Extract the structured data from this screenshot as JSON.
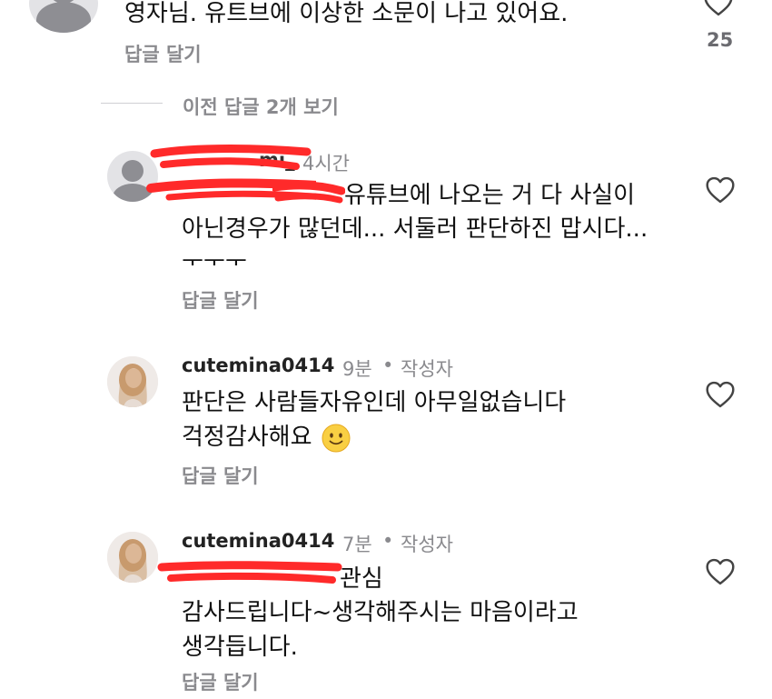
{
  "top_comment": {
    "text": "영자님.  유트브에 이상한 소문이 나고 있어요.",
    "reply_label": "답글 달기",
    "like_count": "25"
  },
  "view_previous": "이전 답글 2개 보기",
  "replies": [
    {
      "username_visible": "mi_",
      "time": "4시간",
      "line1_visible": "유튜브에 나오는 거 다 사실이",
      "line2": "아닌경우가 많던데... 서둘러 판단하진 맙시다...",
      "line3": "ㅜㅜㅜ",
      "reply_label": "답글 달기"
    },
    {
      "username": "cutemina0414",
      "time": "9분",
      "author_badge": "작성자",
      "line1": "판단은 사람들자유인데 아무일없습니다",
      "line2": "걱정감사해요",
      "reply_label": "답글 달기"
    },
    {
      "username": "cutemina0414",
      "time": "7분",
      "author_badge": "작성자",
      "line1_visible": "관심",
      "line2": "감사드립니다~생각해주시는 마음이라고",
      "line3": "생각듭니다.",
      "reply_label": "답글 달기"
    }
  ],
  "icons": {
    "heart": "heart-outline-icon",
    "default_avatar": "person-placeholder-icon",
    "emoji": "slightly-smiling-face-emoji"
  },
  "colors": {
    "text": "#111111",
    "secondary": "#8a8a8e",
    "redaction": "#ff2a2a"
  }
}
